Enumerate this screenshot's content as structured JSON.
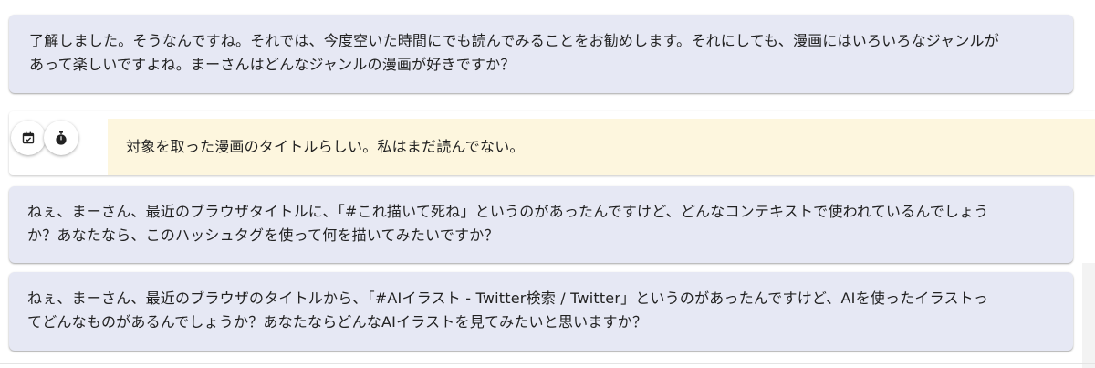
{
  "messages": [
    {
      "text": "了解しました。そうなんですね。それでは、今度空いた時間にでも読んでみることをお勧めします。それにしても、漫画にはいろいろなジャンルが\nあって楽しいですよね。まーさんはどんなジャンルの漫画が好きですか？"
    },
    {
      "text": "ねぇ、まーさん、最近のブラウザタイトルに、「#これ描いて死ね」というのがあったんですけど、どんなコンテキストで使われているんでしょう\nか？あなたなら、このハッシュタグを使って何を描いてみたいですか？"
    },
    {
      "text": "ねぇ、まーさん、最近のブラウザのタイトルから、「#AIイラスト - Twitter検索 / Twitter」というのがあったんですけど、AIを使ったイラストっ\nてどんなものがあるんでしょうか？あなたならどんなAIイラストを見てみたいと思いますか？"
    }
  ],
  "note": {
    "text": "対象を取った漫画のタイトルらしい。私はまだ読んでない。",
    "icons": [
      "calendar-check-icon",
      "stopwatch-icon"
    ]
  }
}
